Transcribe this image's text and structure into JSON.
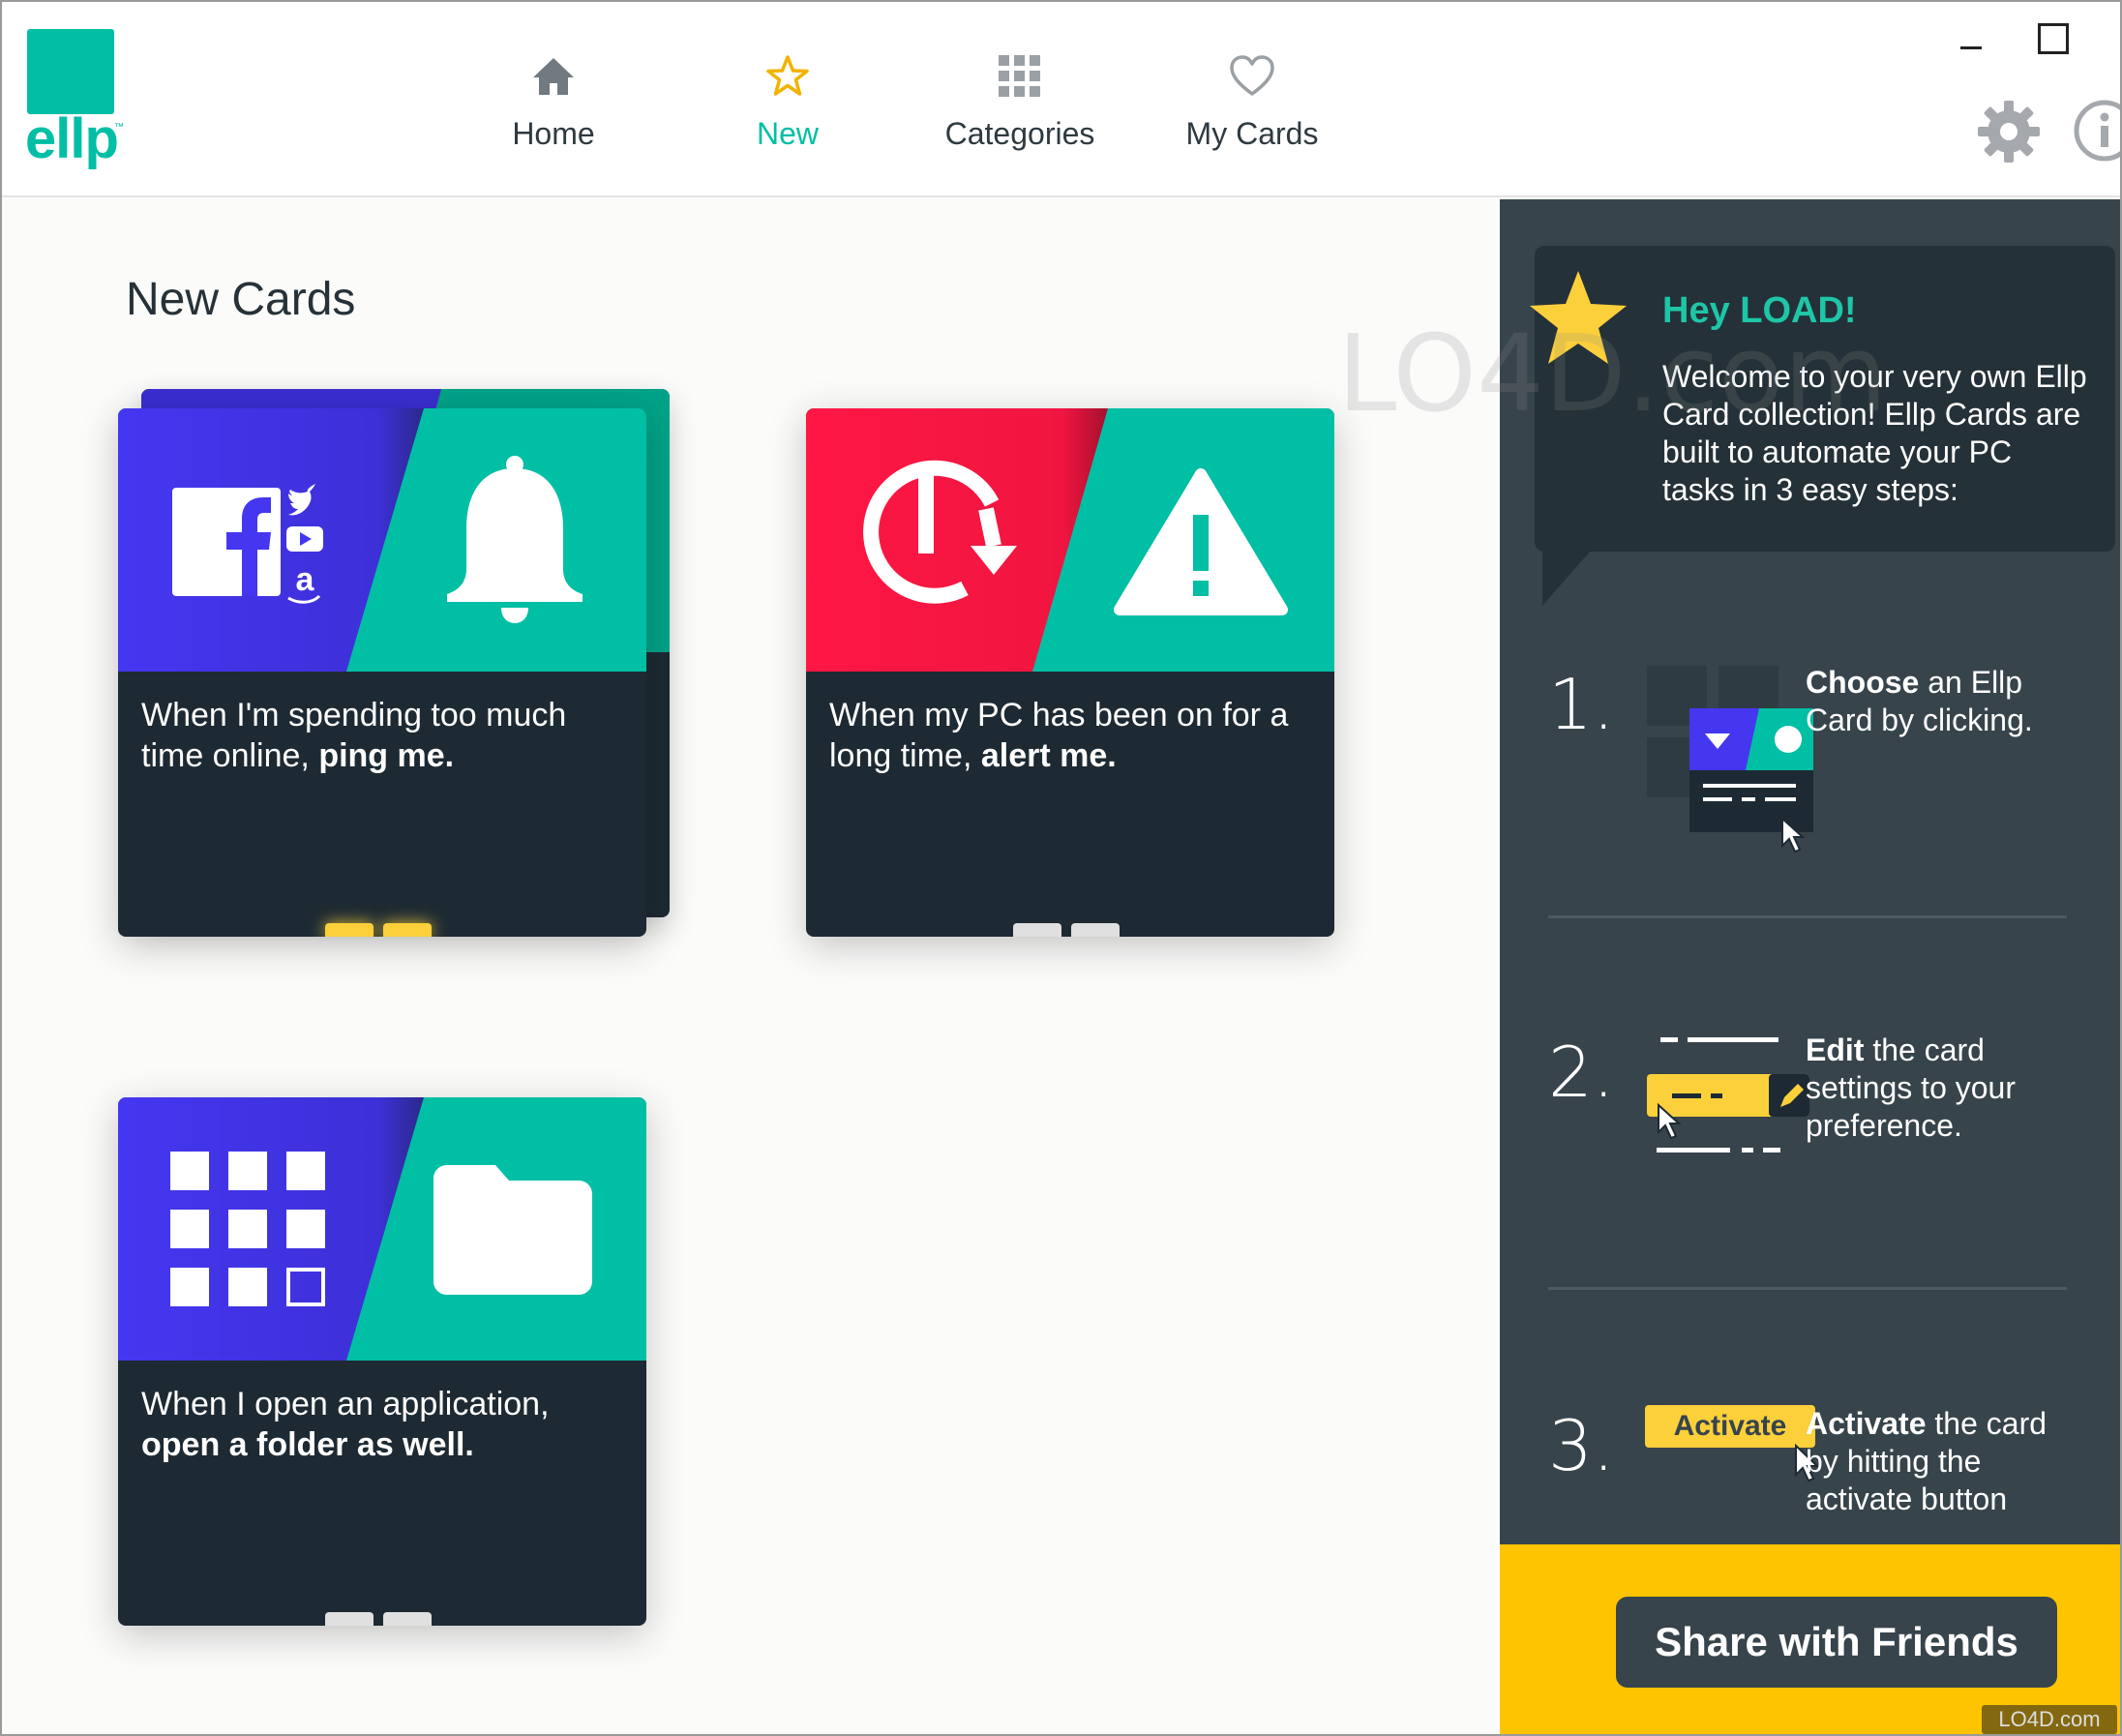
{
  "app": {
    "logo_text": "ellp"
  },
  "nav": {
    "items": [
      {
        "label": "Home",
        "icon": "home-icon"
      },
      {
        "label": "New",
        "icon": "star-outline-icon",
        "active": true
      },
      {
        "label": "Categories",
        "icon": "grid-icon"
      },
      {
        "label": "My Cards",
        "icon": "heart-icon"
      }
    ]
  },
  "window": {
    "minimize_icon": "minimize-icon",
    "maximize_icon": "maximize-icon",
    "settings_icon": "gear-icon",
    "info_icon": "info-icon"
  },
  "main": {
    "title": "New Cards",
    "cards": [
      {
        "text_plain": "When I'm spending too much time online, ",
        "text_bold": "ping me.",
        "left_color": "#4537f0",
        "right_color": "#00bfa5",
        "left_icon": "social-media-icons",
        "right_icon": "bell-icon",
        "hot": true
      },
      {
        "text_plain": "When my PC has been on for a long time, ",
        "text_bold": "alert me.",
        "left_color": "#ff1744",
        "right_color": "#00bfa5",
        "left_icon": "power-timer-icon",
        "right_icon": "warning-icon",
        "hot": false
      },
      {
        "text_plain": "When I open an application, ",
        "text_bold": "open a folder as well.",
        "left_color": "#4537f0",
        "right_color": "#00bfa5",
        "left_icon": "apps-grid-icon",
        "right_icon": "folder-icon",
        "hot": false
      }
    ]
  },
  "side": {
    "greeting": "Hey LOAD!",
    "intro": "Welcome to your very own Ellp Card collection! Ellp Cards are built to automate your PC tasks in 3 easy steps:",
    "steps": [
      {
        "num": "1.",
        "bold": "Choose",
        "rest": " an Ellp Card by clicking."
      },
      {
        "num": "2.",
        "bold": "Edit",
        "rest": " the card settings to your preference."
      },
      {
        "num": "3.",
        "bold": "Activate",
        "rest": " the card by hitting the activate button"
      }
    ],
    "activate_chip": "Activate",
    "share_button": "Share with Friends"
  },
  "watermark": {
    "text": "LO4D.com"
  },
  "colors": {
    "accent": "#00bfa5",
    "dark": "#1d2a33",
    "panel": "#37444c",
    "yellow": "#ffc400",
    "indigo": "#4537f0",
    "red": "#ff1744"
  }
}
